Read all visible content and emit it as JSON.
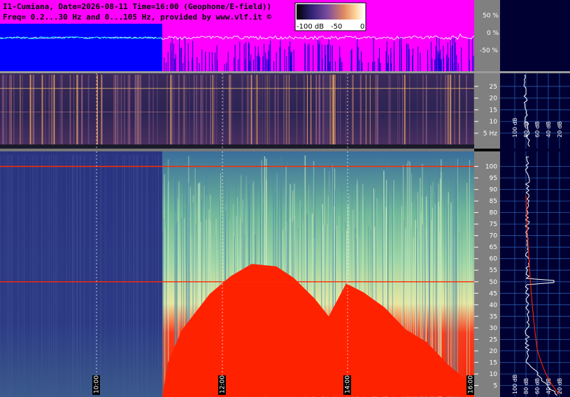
{
  "header": {
    "line1": "I1-Cumiana, Date=2026-08-11 Time=16:00 (Geophone/E-field))",
    "line2": "Freq= 0.2...30 Hz and 0...105 Hz, provided by www.vlf.it ©"
  },
  "colorbar": {
    "ticks": [
      "-100 dB",
      "-50",
      "0"
    ],
    "stops": [
      "#000000",
      "#2a1f6e",
      "#7a4aa0",
      "#e08a60",
      "#ffd9a0",
      "#ffffff"
    ]
  },
  "chart_data": [
    {
      "type": "line",
      "panel": "waveform",
      "y_ticks": [
        "50 %",
        "0 %",
        "-50 %"
      ],
      "y_values": [
        50,
        0,
        -50
      ],
      "ylim": [
        -100,
        100
      ],
      "colors": {
        "background_quiet": "#0000ff",
        "background_active": "#ff00ff",
        "trace": "#ffffff",
        "trace_quiet": "#00ffff"
      }
    },
    {
      "type": "heatmap",
      "panel": "spectrogram-low",
      "unit": "Hz",
      "y_ticks": [
        "25",
        "20",
        "15",
        "10",
        "5 Hz"
      ],
      "y_values": [
        25,
        20,
        15,
        10,
        5
      ],
      "ylim": [
        0.2,
        30
      ],
      "spectrum_labels": [
        "100 dB",
        "80 dB",
        "60 dB",
        "40 dB",
        "20 dB"
      ]
    },
    {
      "type": "heatmap",
      "panel": "spectrogram-high",
      "y_ticks": [
        "100",
        "95",
        "90",
        "85",
        "80",
        "75",
        "70",
        "65",
        "60",
        "55",
        "50",
        "45",
        "40",
        "35",
        "30",
        "25",
        "20",
        "15",
        "10",
        "5"
      ],
      "y_values": [
        100,
        95,
        90,
        85,
        80,
        75,
        70,
        65,
        60,
        55,
        50,
        45,
        40,
        35,
        30,
        25,
        20,
        15,
        10,
        5
      ],
      "ylim": [
        0,
        105
      ],
      "x_ticks": [
        "10:00",
        "12:00",
        "14:00",
        "16:00"
      ],
      "spectrum_labels": [
        "100 dB",
        "80 dB",
        "60 dB",
        "40 dB",
        "20 dB"
      ],
      "marker_lines_hz": [
        50,
        100
      ],
      "colors": {
        "low": "#1e2a7a",
        "mid": "#5fae8a",
        "high": "#f0e8a0",
        "max": "#ff2200"
      }
    }
  ]
}
